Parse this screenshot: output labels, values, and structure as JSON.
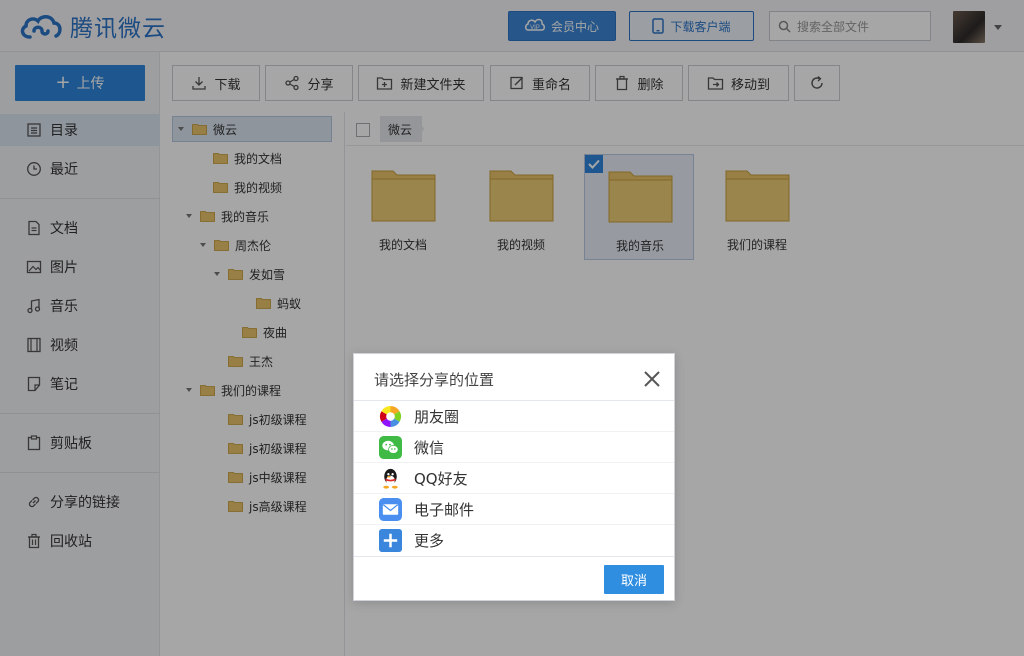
{
  "header": {
    "logo_text": "腾讯微云",
    "vip_label": "会员中心",
    "client_label": "下载客户端",
    "search_placeholder": "搜索全部文件"
  },
  "sidebar": {
    "upload_label": "上传",
    "items": [
      {
        "label": "目录",
        "icon": "list-icon"
      },
      {
        "label": "最近",
        "icon": "clock-icon"
      },
      {
        "label": "文档",
        "icon": "document-icon"
      },
      {
        "label": "图片",
        "icon": "image-icon"
      },
      {
        "label": "音乐",
        "icon": "music-icon"
      },
      {
        "label": "视频",
        "icon": "video-icon"
      },
      {
        "label": "笔记",
        "icon": "note-icon"
      },
      {
        "label": "剪贴板",
        "icon": "clipboard-icon"
      },
      {
        "label": "分享的链接",
        "icon": "link-icon"
      },
      {
        "label": "回收站",
        "icon": "trash-icon"
      }
    ]
  },
  "toolbar": {
    "download": "下载",
    "share": "分享",
    "new_folder": "新建文件夹",
    "rename": "重命名",
    "delete": "删除",
    "move_to": "移动到"
  },
  "tree": {
    "nodes": [
      {
        "label": "微云"
      },
      {
        "label": "我的文档"
      },
      {
        "label": "我的视频"
      },
      {
        "label": "我的音乐"
      },
      {
        "label": "周杰伦"
      },
      {
        "label": "发如雪"
      },
      {
        "label": "蚂蚁"
      },
      {
        "label": "夜曲"
      },
      {
        "label": "王杰"
      },
      {
        "label": "我们的课程"
      },
      {
        "label": "js初级课程"
      },
      {
        "label": "js初级课程"
      },
      {
        "label": "js中级课程"
      },
      {
        "label": "js高级课程"
      }
    ]
  },
  "breadcrumb": {
    "current": "微云"
  },
  "files": [
    {
      "name": "我的文档"
    },
    {
      "name": "我的视频"
    },
    {
      "name": "我的音乐"
    },
    {
      "name": "我们的课程"
    }
  ],
  "dialog": {
    "title": "请选择分享的位置",
    "options": [
      {
        "label": "朋友圈",
        "icon": "moments-icon"
      },
      {
        "label": "微信",
        "icon": "wechat-icon"
      },
      {
        "label": "QQ好友",
        "icon": "qq-icon"
      },
      {
        "label": "电子邮件",
        "icon": "email-icon"
      },
      {
        "label": "更多",
        "icon": "plus-icon"
      }
    ],
    "cancel": "取消"
  },
  "colors": {
    "accent": "#2f86dc",
    "folder": "#e9c46a",
    "folder_dark": "#d4a93c"
  }
}
